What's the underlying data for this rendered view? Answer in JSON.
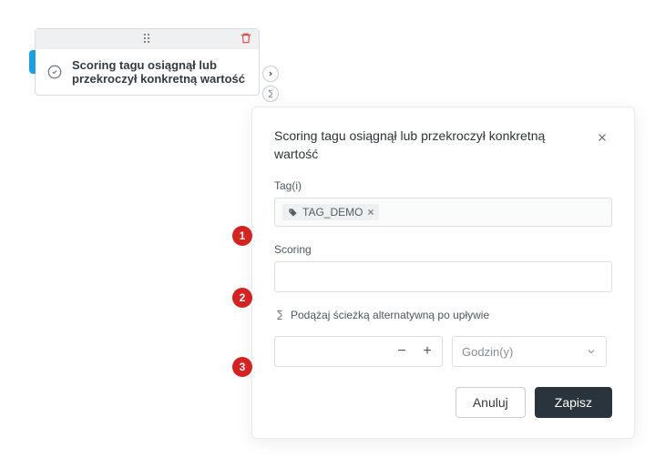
{
  "node": {
    "title": "Scoring tagu osiągnął lub przekroczył konkretną wartość"
  },
  "panel": {
    "title": "Scoring tagu osiągnął lub przekroczył konkretną wartość",
    "tag_label": "Tag(i)",
    "tag_value": "TAG_DEMO",
    "scoring_label": "Scoring",
    "scoring_value": "",
    "alt_label": "Podążaj ścieżką alternatywną po upływie",
    "stepper_value": "",
    "unit_selected": "Godzin(y)",
    "cancel": "Anuluj",
    "save": "Zapisz"
  },
  "markers": {
    "m1": "1",
    "m2": "2",
    "m3": "3"
  }
}
